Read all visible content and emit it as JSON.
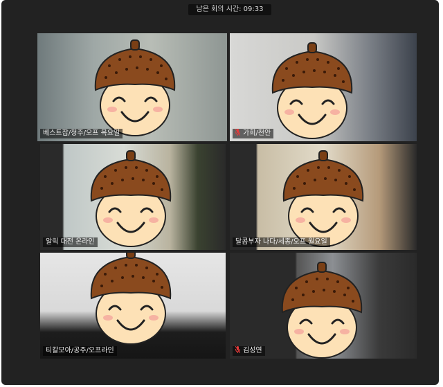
{
  "meeting": {
    "timer_label": "남은 회의 시간: 09:33"
  },
  "participants": [
    {
      "name": "베스트잡/청주/오프 목요일",
      "muted": false,
      "active_speaker": true
    },
    {
      "name": "가희/천안",
      "muted": true,
      "active_speaker": false
    },
    {
      "name": "알릭 대전 온라인",
      "muted": false,
      "active_speaker": false
    },
    {
      "name": "달콤부자 나다/세종/오프 월요일",
      "muted": false,
      "active_speaker": false
    },
    {
      "name": "티칼모아/공주/오프라인",
      "muted": false,
      "active_speaker": false
    },
    {
      "name": "김성연",
      "muted": true,
      "active_speaker": false
    }
  ],
  "colors": {
    "active_border": "#b9d44c",
    "muted_icon": "#e23a3a",
    "acorn_cap": "#8a4a1e",
    "face": "#fde1b6"
  }
}
